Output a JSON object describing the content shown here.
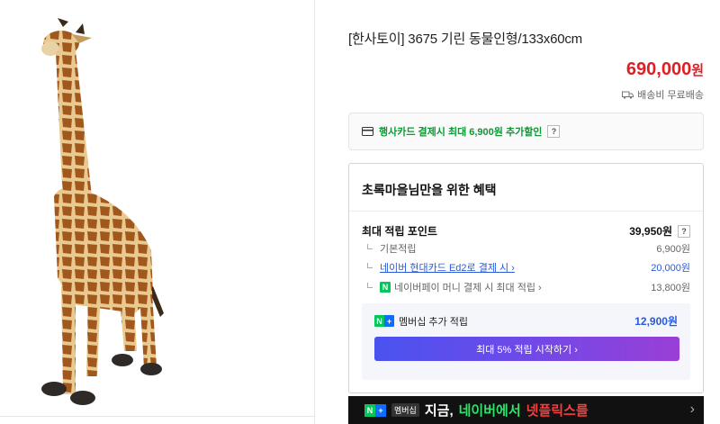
{
  "product": {
    "title": "[한사토이] 3675 기린 동물인형/133x60cm",
    "price_value": "690,000",
    "price_unit": "원",
    "shipping": "배송비 무료배송",
    "image_icon": "giraffe-plush-photo"
  },
  "card_offer": {
    "text": "행사카드 결제시 최대 6,900원 추가할인",
    "help": "?"
  },
  "benefit": {
    "title": "초록마을님만을 위한 혜택",
    "max_points_label": "최대 적립 포인트",
    "max_points_value": "39,950원",
    "max_points_help": "?",
    "rows": [
      {
        "label": "기본적립",
        "value": "6,900원"
      },
      {
        "label": "네이버 현대카드 Ed2로 결제 시 ›",
        "value": "20,000원"
      },
      {
        "label": "네이버페이 머니 결제 시 최대 적립 ›",
        "value": "13,800원"
      }
    ],
    "membership": {
      "badge_n": "N",
      "badge_plus": "+",
      "label": "멤버십 추가 적립",
      "value": "12,900원",
      "button_label": "최대 5% 적립 시작하기 ›"
    }
  },
  "banner": {
    "badge_n": "N",
    "badge_plus": "+",
    "badge_text": "멤버십",
    "text_prefix": "지금,",
    "text_green": "네이버에서",
    "text_red": "넷플릭스를",
    "close_glyph": "›"
  },
  "colors": {
    "price": "#e01f25",
    "green": "#0b9a35",
    "link": "#2a5ad6",
    "naver_green": "#03c75a"
  }
}
